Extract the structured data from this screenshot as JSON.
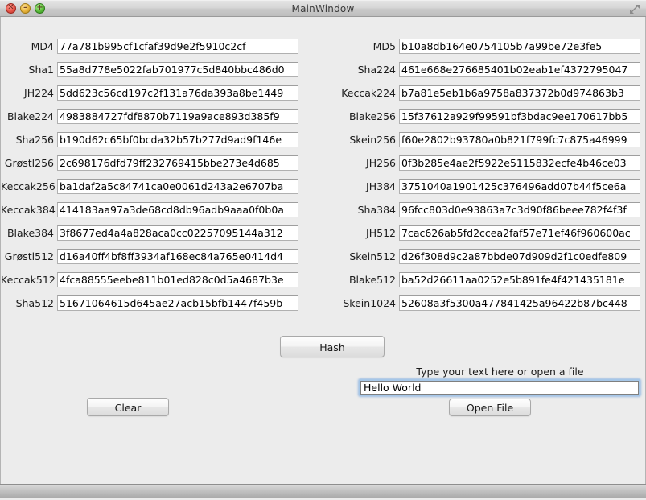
{
  "window": {
    "title": "MainWindow",
    "controls": {
      "close": "✕",
      "minimize": "–",
      "maximize": "+"
    },
    "expand_icon": "expand-icon"
  },
  "hashes": {
    "left": [
      {
        "label": "MD4",
        "value": "77a781b995cf1cfaf39d9e2f5910c2cf"
      },
      {
        "label": "Sha1",
        "value": "55a8d778e5022fab701977c5d840bbc486d0"
      },
      {
        "label": "JH224",
        "value": "5dd623c56cd197c2f131a76da393a8be1449"
      },
      {
        "label": "Blake224",
        "value": "4983884727fdf8870b7119a9ace893d385f9"
      },
      {
        "label": "Sha256",
        "value": "b190d62c65bf0bcda32b57b277d9ad9f146e"
      },
      {
        "label": "Grøstl256",
        "value": "2c698176dfd79ff232769415bbe273e4d685"
      },
      {
        "label": "Keccak256",
        "value": "ba1daf2a5c84741ca0e0061d243a2e6707ba"
      },
      {
        "label": "Keccak384",
        "value": "414183aa97a3de68cd8db96adb9aaa0f0b0a"
      },
      {
        "label": "Blake384",
        "value": "3f8677ed4a4a828aca0cc02257095144a312"
      },
      {
        "label": "Grøstl512",
        "value": "d16a40ff4bf8ff3934af168ec84a765e0414d4"
      },
      {
        "label": "Keccak512",
        "value": "4fca88555eebe811b01ed828c0d5a4687b3e"
      },
      {
        "label": "Sha512",
        "value": "51671064615d645ae27acb15bfb1447f459b"
      }
    ],
    "right": [
      {
        "label": "MD5",
        "value": "b10a8db164e0754105b7a99be72e3fe5"
      },
      {
        "label": "Sha224",
        "value": "461e668e276685401b02eab1ef4372795047"
      },
      {
        "label": "Keccak224",
        "value": "b7a81e5eb1b6a9758a837372b0d974863b3"
      },
      {
        "label": "Blake256",
        "value": "15f37612a929f99591bf3bdac9ee170617bb5"
      },
      {
        "label": "Skein256",
        "value": "f60e2802b93780a0b821f799fc7c875a46999"
      },
      {
        "label": "JH256",
        "value": "0f3b285e4ae2f5922e5115832ecfe4b46ce03"
      },
      {
        "label": "JH384",
        "value": "3751040a1901425c376496add07b44f5ce6a"
      },
      {
        "label": "Sha384",
        "value": "96fcc803d0e93863a7c3d90f86beee782f4f3f"
      },
      {
        "label": "JH512",
        "value": "7cac626ab5fd2ccea2faf57e71ef46f960600ac"
      },
      {
        "label": "Skein512",
        "value": "d26f308d9c2a87bbde07d909d2f1c0edfe809"
      },
      {
        "label": "Blake512",
        "value": "ba52d26611aa0252e5b891fe4f421435181e"
      },
      {
        "label": "Skein1024",
        "value": "52608a3f5300a477841425a96422b87bc448"
      }
    ]
  },
  "actions": {
    "hash_label": "Hash",
    "clear_label": "Clear",
    "open_file_label": "Open File"
  },
  "input": {
    "caption": "Type your text here or open a file",
    "value": "Hello World",
    "placeholder": "Type your text here or open a file"
  }
}
